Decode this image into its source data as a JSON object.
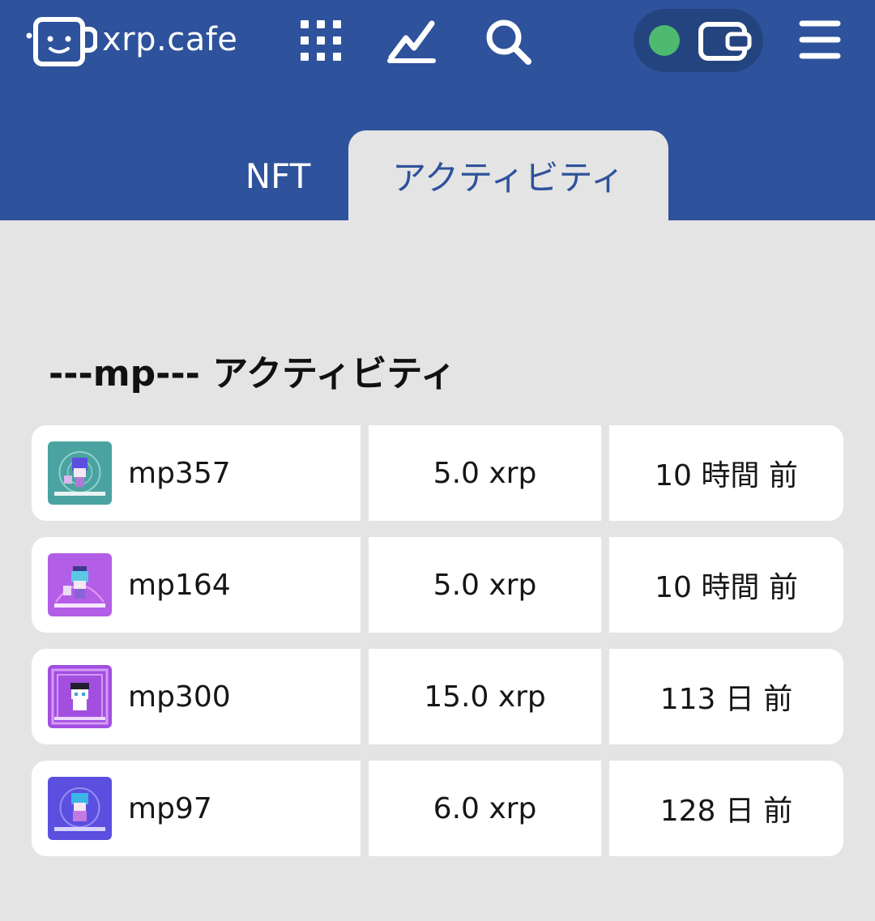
{
  "header": {
    "brand": "xrp.cafe",
    "icons": {
      "grid": "grid-icon",
      "stats": "chart-line-icon",
      "search": "search-icon",
      "wallet": "wallet-icon",
      "menu": "hamburger-menu-icon"
    },
    "wallet_status_color": "#4dba6f"
  },
  "tabs": [
    {
      "label": "NFT",
      "active": false
    },
    {
      "label": "アクティビティ",
      "active": true
    }
  ],
  "heading": "---mp--- アクティビティ",
  "activity": [
    {
      "name": "mp357",
      "price": "5.0 xrp",
      "time": "10 時間 前",
      "thumb_colors": [
        "#4aa3a0",
        "#8fd1c8"
      ]
    },
    {
      "name": "mp164",
      "price": "5.0 xrp",
      "time": "10 時間 前",
      "thumb_colors": [
        "#b35ee6",
        "#e39cf5"
      ]
    },
    {
      "name": "mp300",
      "price": "15.0 xrp",
      "time": "113 日 前",
      "thumb_colors": [
        "#a24fe0",
        "#d59af7"
      ]
    },
    {
      "name": "mp97",
      "price": "6.0 xrp",
      "time": "128 日 前",
      "thumb_colors": [
        "#5b4fe0",
        "#9a8df2"
      ]
    }
  ],
  "colors": {
    "header_bg": "#2e529b",
    "page_bg": "#e4e4e4",
    "active_tab_text": "#2e529b"
  }
}
